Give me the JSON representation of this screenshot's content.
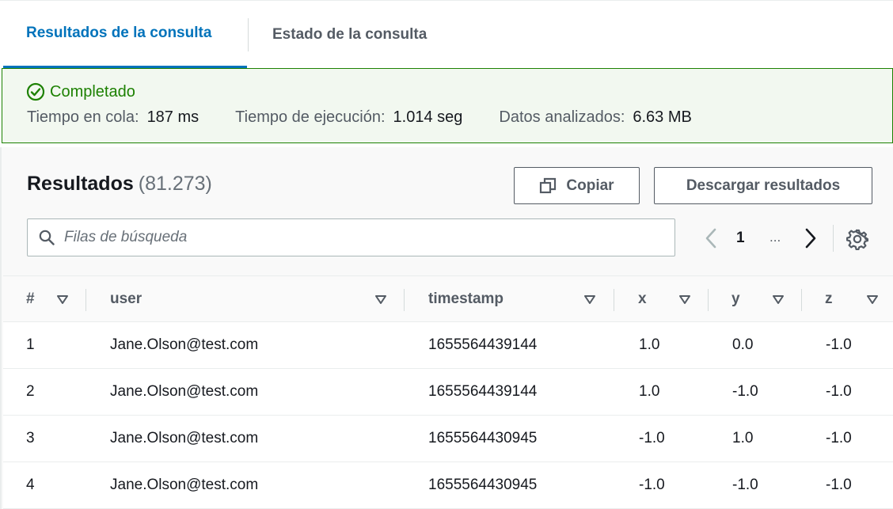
{
  "tabs": [
    {
      "label": "Resultados de la consulta",
      "active": true
    },
    {
      "label": "Estado de la consulta",
      "active": false
    }
  ],
  "status": {
    "label": "Completado",
    "color": "#1d8102",
    "queue_label": "Tiempo en cola:",
    "queue_value": "187 ms",
    "exec_label": "Tiempo de ejecución:",
    "exec_value": "1.014 seg",
    "scanned_label": "Datos analizados:",
    "scanned_value": "6.63 MB"
  },
  "results": {
    "title": "Resultados",
    "count": "(81.273)",
    "copy_label": "Copiar",
    "download_label": "Descargar resultados",
    "search_placeholder": "Filas de búsqueda",
    "page": "1",
    "ellipsis": "..."
  },
  "table": {
    "columns": [
      "#",
      "user",
      "timestamp",
      "x",
      "y",
      "z"
    ],
    "rows": [
      [
        "1",
        "Jane.Olson@test.com",
        "1655564439144",
        "1.0",
        "0.0",
        "-1.0"
      ],
      [
        "2",
        "Jane.Olson@test.com",
        "1655564439144",
        "1.0",
        "-1.0",
        "-1.0"
      ],
      [
        "3",
        "Jane.Olson@test.com",
        "1655564430945",
        "-1.0",
        "1.0",
        "-1.0"
      ],
      [
        "4",
        "Jane.Olson@test.com",
        "1655564430945",
        "-1.0",
        "-1.0",
        "-1.0"
      ]
    ]
  },
  "icons": {
    "status": "check-circle-icon",
    "copy": "copy-icon",
    "search": "search-icon",
    "prev": "chevron-left-icon",
    "next": "chevron-right-icon",
    "settings": "gear-icon",
    "sort": "sort-caret-icon"
  },
  "colors": {
    "accent": "#0073bb",
    "success": "#1d8102",
    "success_bg": "#f2f8f0"
  }
}
